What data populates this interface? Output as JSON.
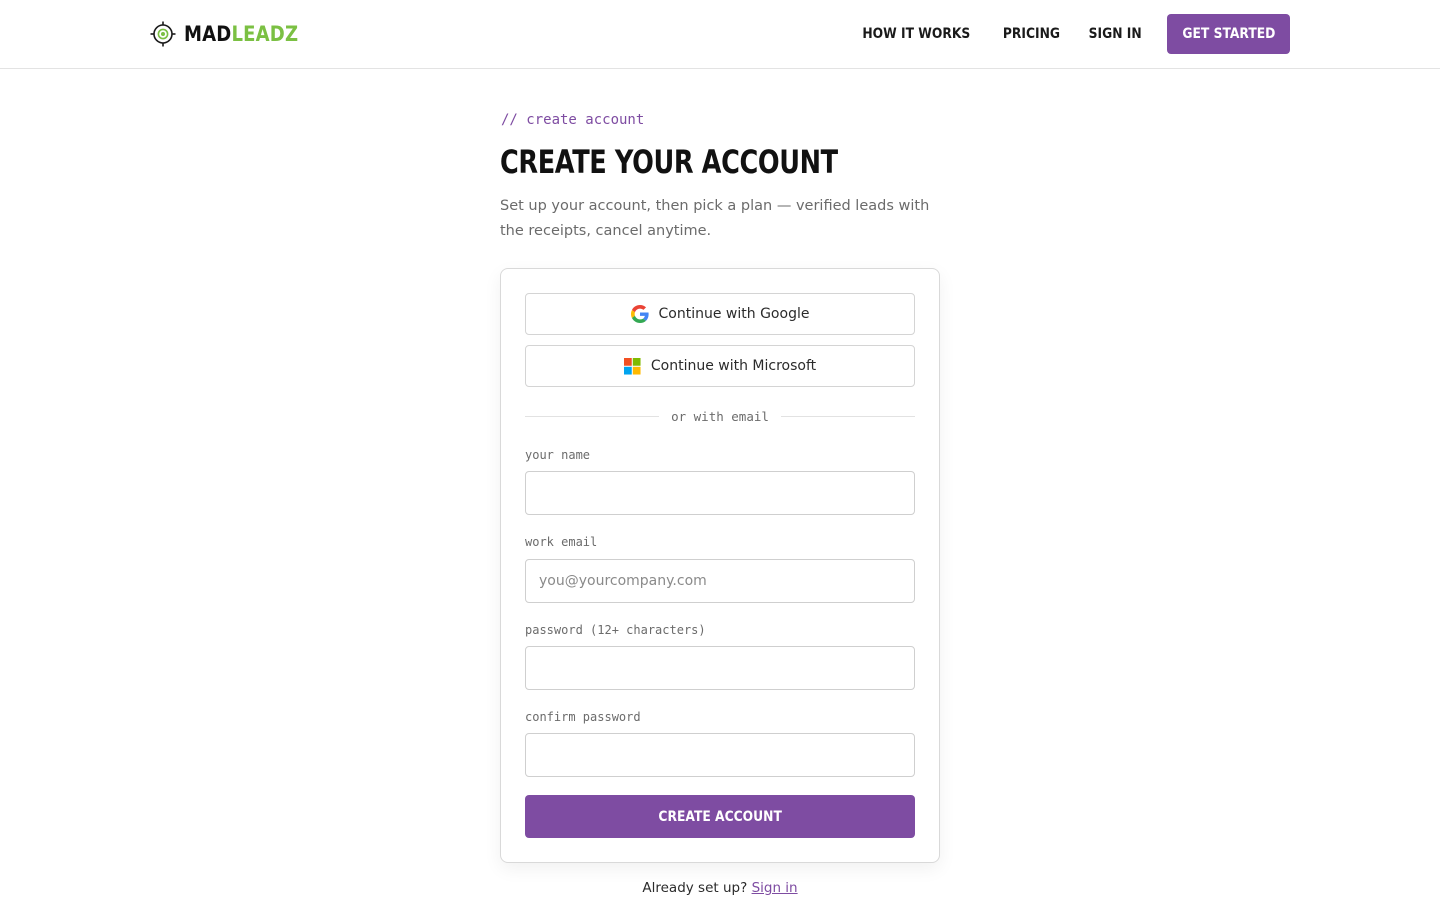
{
  "brand": {
    "name_part1": "MAD",
    "name_part2": "LEADZ",
    "accent": "#7e4ca2",
    "logo_green": "#7bc043",
    "logo_icon": "target-icon"
  },
  "nav": {
    "items": [
      {
        "label": "HOW IT WORKS"
      },
      {
        "label": "PRICING"
      },
      {
        "label": "SIGN IN"
      }
    ],
    "cta_label": "GET STARTED"
  },
  "intro": {
    "eyebrow": "// create account",
    "title": "CREATE YOUR ACCOUNT",
    "subtitle": "Set up your account, then pick a plan — verified leads with the receipts, cancel anytime."
  },
  "oauth": {
    "google_label": "Continue with Google",
    "google_icon": "google-icon",
    "microsoft_label": "Continue with Microsoft",
    "microsoft_icon": "microsoft-icon"
  },
  "divider_text": "or with email",
  "form": {
    "name": {
      "label": "your name",
      "value": "",
      "placeholder": ""
    },
    "email": {
      "label": "work email",
      "value": "",
      "placeholder": "you@yourcompany.com"
    },
    "password": {
      "label": "password (12+ characters)",
      "value": "",
      "placeholder": ""
    },
    "confirm": {
      "label": "confirm password",
      "value": "",
      "placeholder": ""
    },
    "submit_label": "CREATE ACCOUNT"
  },
  "footer": {
    "prompt": "Already set up?",
    "link_label": "Sign in"
  }
}
